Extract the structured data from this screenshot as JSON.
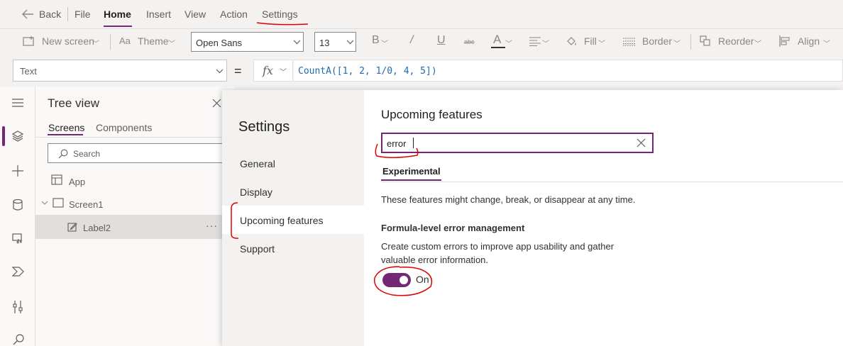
{
  "menubar": {
    "back_label": "Back",
    "items": [
      "File",
      "Home",
      "Insert",
      "View",
      "Action",
      "Settings"
    ],
    "active": "Home"
  },
  "toolbar": {
    "new_screen": "New screen",
    "theme": "Theme",
    "font": "Open Sans",
    "font_size": "13",
    "fill": "Fill",
    "border": "Border",
    "reorder": "Reorder",
    "align": "Align"
  },
  "formula": {
    "property": "Text",
    "equals": "=",
    "fx": "fx",
    "expression": "CountA([1, 2, 1/0, 4, 5])"
  },
  "tree": {
    "title": "Tree view",
    "tabs": [
      "Screens",
      "Components"
    ],
    "search_placeholder": "Search",
    "items": [
      "App",
      "Screen1",
      "Label2"
    ],
    "more": "···"
  },
  "settings": {
    "title": "Settings",
    "nav": [
      "General",
      "Display",
      "Upcoming features",
      "Support"
    ],
    "selected_nav": "Upcoming features",
    "section_title": "Upcoming features",
    "search_value": "error",
    "tab": "Experimental",
    "warning": "These features might change, break, or disappear at any time.",
    "feature_title": "Formula-level error management",
    "feature_desc_line1": "Create custom errors to improve app usability and gather",
    "feature_desc_line2": "valuable error information.",
    "toggle_label": "On",
    "toggle_on": true
  },
  "colors": {
    "accent": "#742774",
    "annotation": "#e00000"
  }
}
